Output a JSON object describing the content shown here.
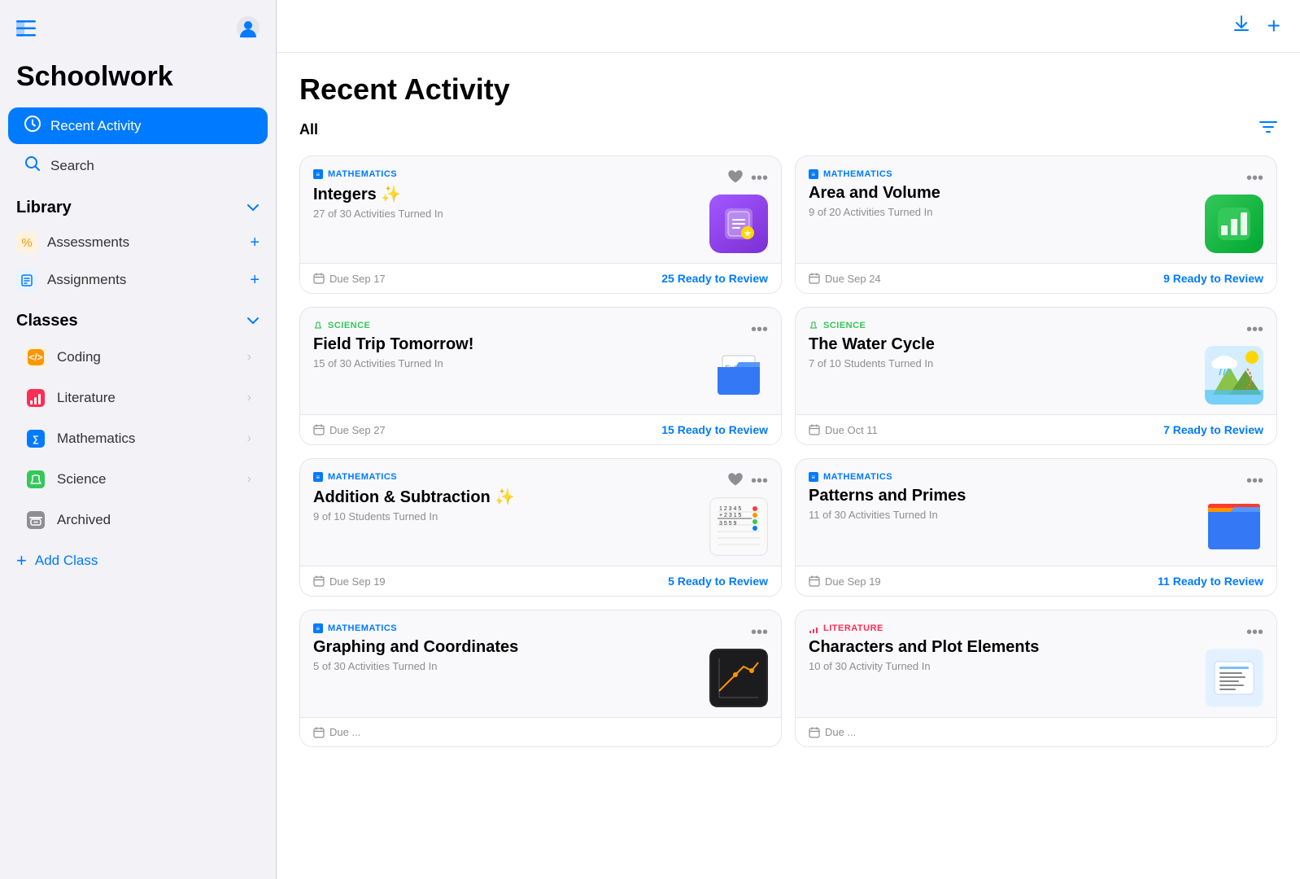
{
  "sidebar": {
    "toggle_icon": "☰",
    "profile_icon": "👤",
    "app_title": "Schoolwork",
    "nav": {
      "recent_activity": "Recent Activity",
      "search": "Search"
    },
    "library": {
      "label": "Library",
      "items": [
        {
          "id": "assessments",
          "label": "Assessments",
          "icon": "%"
        },
        {
          "id": "assignments",
          "label": "Assignments",
          "icon": "📋"
        }
      ]
    },
    "classes": {
      "label": "Classes",
      "items": [
        {
          "id": "coding",
          "label": "Coding",
          "icon": "🟠",
          "color": "#ff9500"
        },
        {
          "id": "literature",
          "label": "Literature",
          "icon": "📊",
          "color": "#ff2d55"
        },
        {
          "id": "mathematics",
          "label": "Mathematics",
          "icon": "🟦",
          "color": "#007aff"
        },
        {
          "id": "science",
          "label": "Science",
          "icon": "🟢",
          "color": "#34c759"
        }
      ]
    },
    "archived": "Archived",
    "add_class": "Add Class"
  },
  "main": {
    "header": {
      "download_icon": "⬇",
      "add_icon": "+"
    },
    "page_title": "Recent Activity",
    "filter_label": "All",
    "cards": [
      {
        "id": "card1",
        "subject": "MATHEMATICS",
        "subject_type": "math",
        "title": "Integers ✨",
        "subtitle": "27 of 30 Activities Turned In",
        "thumb_type": "schoolwork",
        "actions": {
          "heart": true,
          "more": true
        },
        "due": "Due Sep 17",
        "review": "25 Ready to Review"
      },
      {
        "id": "card2",
        "subject": "MATHEMATICS",
        "subject_type": "math",
        "title": "Area and Volume",
        "subtitle": "9 of 20 Activities Turned In",
        "thumb_type": "numbers",
        "actions": {
          "heart": false,
          "more": true
        },
        "due": "Due Sep 24",
        "review": "9 Ready to Review"
      },
      {
        "id": "card3",
        "subject": "SCIENCE",
        "subject_type": "science",
        "title": "Field Trip Tomorrow!",
        "subtitle": "15 of 30 Activities Turned In",
        "thumb_type": "folder-blue",
        "actions": {
          "heart": false,
          "more": true
        },
        "due": "Due Sep 27",
        "review": "15 Ready to Review"
      },
      {
        "id": "card4",
        "subject": "SCIENCE",
        "subject_type": "science",
        "title": "The Water Cycle",
        "subtitle": "7 of 10 Students Turned In",
        "thumb_type": "water-cycle",
        "actions": {
          "heart": false,
          "more": true
        },
        "due": "Due Oct 11",
        "review": "7 Ready to Review"
      },
      {
        "id": "card5",
        "subject": "MATHEMATICS",
        "subject_type": "math",
        "title": "Addition & Subtraction ✨",
        "subtitle": "9 of 10 Students Turned In",
        "thumb_type": "doc-grid",
        "actions": {
          "heart": true,
          "more": true
        },
        "due": "Due Sep 19",
        "review": "5 Ready to Review"
      },
      {
        "id": "card6",
        "subject": "MATHEMATICS",
        "subject_type": "math",
        "title": "Patterns and Primes",
        "subtitle": "11 of 30 Activities Turned In",
        "thumb_type": "folder-colorful",
        "actions": {
          "heart": false,
          "more": true
        },
        "due": "Due Sep 19",
        "review": "11 Ready to Review"
      },
      {
        "id": "card7",
        "subject": "MATHEMATICS",
        "subject_type": "math",
        "title": "Graphing and Coordinates",
        "subtitle": "5 of 30 Activities Turned In",
        "thumb_type": "dark-thumb",
        "actions": {
          "heart": false,
          "more": true
        },
        "due": "Due ...",
        "review": ""
      },
      {
        "id": "card8",
        "subject": "LITERATURE",
        "subject_type": "literature",
        "title": "Characters and Plot Elements",
        "subtitle": "10 of 30 Activity Turned In",
        "thumb_type": "lit-icon",
        "actions": {
          "heart": false,
          "more": true
        },
        "due": "Due ...",
        "review": ""
      }
    ]
  }
}
